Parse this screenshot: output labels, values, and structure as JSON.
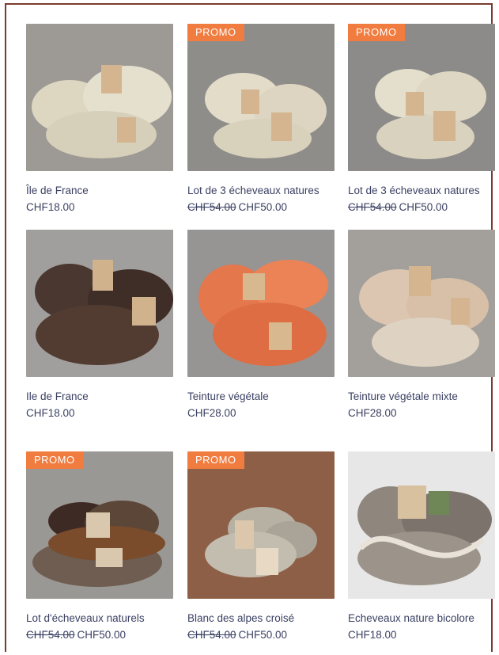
{
  "products": [
    {
      "name": "Île de France",
      "promo": "",
      "old_price": "",
      "price": "CHF18.00",
      "yarn_color": "#ddd6c0",
      "bg_color": "#9d9a96",
      "image_label": "cream yarn skeins"
    },
    {
      "name": "Lot de 3 écheveaux natures",
      "promo": "PROMO",
      "old_price": "CHF54.00",
      "price": "CHF50.00",
      "yarn_color": "#e2dcc9",
      "bg_color": "#8f8d8a",
      "image_label": "natural yarn lot"
    },
    {
      "name": "Lot de 3 écheveaux natures",
      "promo": "PROMO",
      "old_price": "CHF54.00",
      "price": "CHF50.00",
      "yarn_color": "#e4dfcc",
      "bg_color": "#8d8b89",
      "image_label": "natural yarn lot"
    },
    {
      "name": "Ile de France",
      "promo": "",
      "old_price": "",
      "price": "CHF18.00",
      "yarn_color": "#4a372f",
      "bg_color": "#a19f9d",
      "image_label": "brown yarn skeins"
    },
    {
      "name": "Teinture végétale",
      "promo": "",
      "old_price": "",
      "price": "CHF28.00",
      "yarn_color": "#e5774d",
      "bg_color": "#969594",
      "image_label": "orange dyed yarn"
    },
    {
      "name": "Teinture végétale mixte",
      "promo": "",
      "old_price": "",
      "price": "CHF28.00",
      "yarn_color": "#dcc6b1",
      "bg_color": "#a3a09b",
      "image_label": "beige mixed yarn"
    },
    {
      "name": "Lot d'écheveaux naturels",
      "promo": "PROMO",
      "old_price": "CHF54.00",
      "price": "CHF50.00",
      "yarn_color": "#5b4638",
      "bg_color": "#9a9894",
      "image_label": "brown and grey yarn lot"
    },
    {
      "name": "Blanc des alpes croisé",
      "promo": "PROMO",
      "old_price": "CHF54.00",
      "price": "CHF50.00",
      "yarn_color": "#b7b1a4",
      "bg_color": "#8e5f47",
      "image_label": "grey yarn skeins"
    },
    {
      "name": "Echeveaux nature bicolore",
      "promo": "",
      "old_price": "",
      "price": "CHF18.00",
      "yarn_color": "#8f877e",
      "bg_color": "#e8e7e7",
      "image_label": "bicolor yarn skeins"
    }
  ]
}
